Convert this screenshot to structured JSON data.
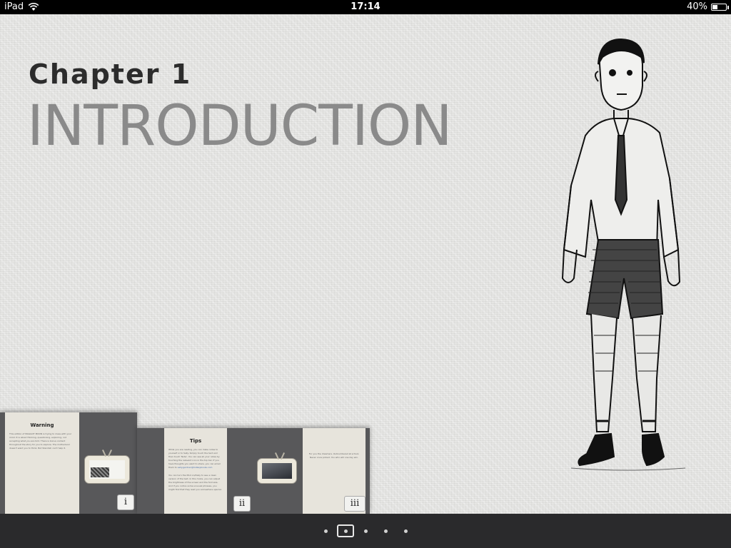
{
  "status_bar": {
    "device": "iPad",
    "time": "17:14",
    "battery": "40%",
    "battery_level": 0.4
  },
  "chapter": {
    "label": "Chapter 1",
    "title": "INTRODUCTION"
  },
  "thumbnails": [
    {
      "title": "Warning",
      "text": "This edition of MAGGOT MOON is trying to mess with your mind. It is about thinking, questioning, exploring, not accepting what you are told. There is bonus content throughout the story for you to explore. The motherland doesn't want you to think. But Standish can't help it.",
      "number": "i"
    },
    {
      "title": "Tips",
      "text": "While you are reading, you can make notes to yourself or to Sally. Simply touch the text and then touch 'Note'. You can see all your notes by touching the relevant icon in the top bar. If you have thoughts you want to share, you can email them to",
      "link": "sally.gardner@hotkeybooks.com",
      "text2": "You can turn the Mod on/Daily to see a clean version of the text. In this mode, you can adjust the brightness of the screen and the font size. And if you notice some unusual phrases, you might find that they lead you somewhere special.",
      "number": "ii"
    },
    {
      "text": "For you the dreamers. Outnumbered at school. Never once picked. You who will one day win.",
      "number": "iii"
    }
  ],
  "page_indicator": {
    "total": 5,
    "current": 2
  }
}
